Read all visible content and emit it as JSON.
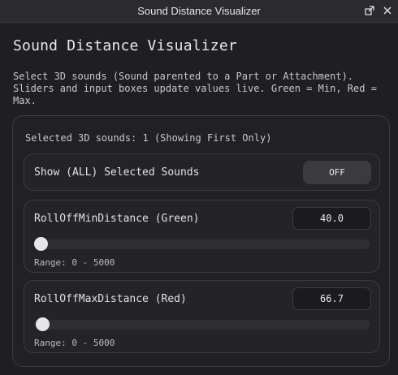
{
  "window": {
    "title": "Sound Distance Visualizer",
    "icons": [
      "restore-icon",
      "close-icon"
    ]
  },
  "main": {
    "heading": "Sound Distance Visualizer",
    "description": "Select 3D sounds (Sound parented to a Part or Attachment). Sliders and input boxes update values live. Green = Min, Red = Max."
  },
  "panel": {
    "selected_text": "Selected 3D sounds: 1 (Showing First Only)",
    "toggle": {
      "label": "Show (ALL) Selected Sounds",
      "state": "OFF"
    },
    "min": {
      "label": "RollOffMinDistance (Green)",
      "value": "40.0",
      "slider_fraction": 0.008,
      "range_text": "Range: 0 - 5000"
    },
    "max": {
      "label": "RollOffMaxDistance (Red)",
      "value": "66.7",
      "slider_fraction": 0.0133,
      "range_text": "Range: 0 - 5000"
    }
  },
  "colors": {
    "background": "#1f1f23",
    "panel_border": "#3c3c42",
    "thumb": "#e6e6e8"
  }
}
